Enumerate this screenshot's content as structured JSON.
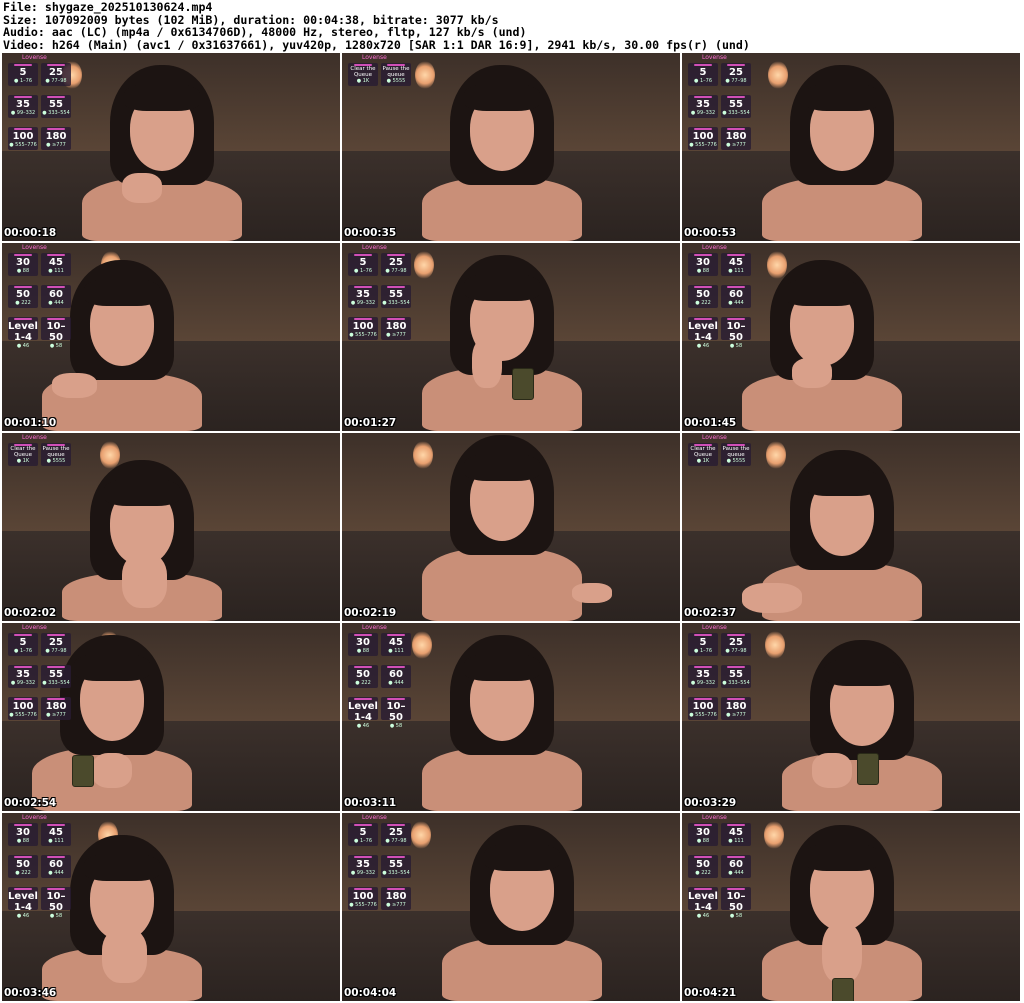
{
  "header": {
    "file_line": "File: shygaze_202510130624.mp4",
    "size_line": "Size: 107092009 bytes (102 MiB), duration: 00:04:38, bitrate: 3077 kb/s",
    "audio_line": "Audio: aac (LC) (mp4a / 0x6134706D), 48000 Hz, stereo, fltp, 127 kb/s (und)",
    "video_line": "Video: h264 (Main) (avc1 / 0x31637661), yuv420p, 1280x720 [SAR 1:1 DAR 16:9], 2941 kb/s, 30.00 fps(r) (und)"
  },
  "overlay": {
    "brand": "Lovense",
    "set_a": [
      {
        "big": "5",
        "small": "1–76"
      },
      {
        "big": "25",
        "small": "77–98"
      },
      {
        "big": "35",
        "small": "99–332"
      },
      {
        "big": "55",
        "small": "333–554"
      },
      {
        "big": "100",
        "small": "555–776"
      },
      {
        "big": "180",
        "small": "≥777"
      }
    ],
    "set_b": [
      {
        "big": "30",
        "small": "88"
      },
      {
        "big": "45",
        "small": "111"
      },
      {
        "big": "50",
        "small": "222"
      },
      {
        "big": "60",
        "small": "444"
      },
      {
        "big": "1-4",
        "small": "46",
        "pre": "Level"
      },
      {
        "big": "10–50",
        "small": "58"
      }
    ],
    "set_c": [
      {
        "top": "Clear the Queue",
        "small": "1K"
      },
      {
        "top": "Pause the queue",
        "small": "5555"
      }
    ]
  },
  "thumbnails": [
    {
      "time": "00:00:18",
      "overlay": "a"
    },
    {
      "time": "00:00:35",
      "overlay": "c"
    },
    {
      "time": "00:00:53",
      "overlay": "a"
    },
    {
      "time": "00:01:10",
      "overlay": "b"
    },
    {
      "time": "00:01:27",
      "overlay": "a"
    },
    {
      "time": "00:01:45",
      "overlay": "b"
    },
    {
      "time": "00:02:02",
      "overlay": "c"
    },
    {
      "time": "00:02:19",
      "overlay": "none"
    },
    {
      "time": "00:02:37",
      "overlay": "c"
    },
    {
      "time": "00:02:54",
      "overlay": "a"
    },
    {
      "time": "00:03:11",
      "overlay": "b"
    },
    {
      "time": "00:03:29",
      "overlay": "a"
    },
    {
      "time": "00:03:46",
      "overlay": "b"
    },
    {
      "time": "00:04:04",
      "overlay": "a"
    },
    {
      "time": "00:04:21",
      "overlay": "b"
    }
  ],
  "colors": {
    "tile_bar": "#d14fb6",
    "brand": "#ff6ed6"
  }
}
